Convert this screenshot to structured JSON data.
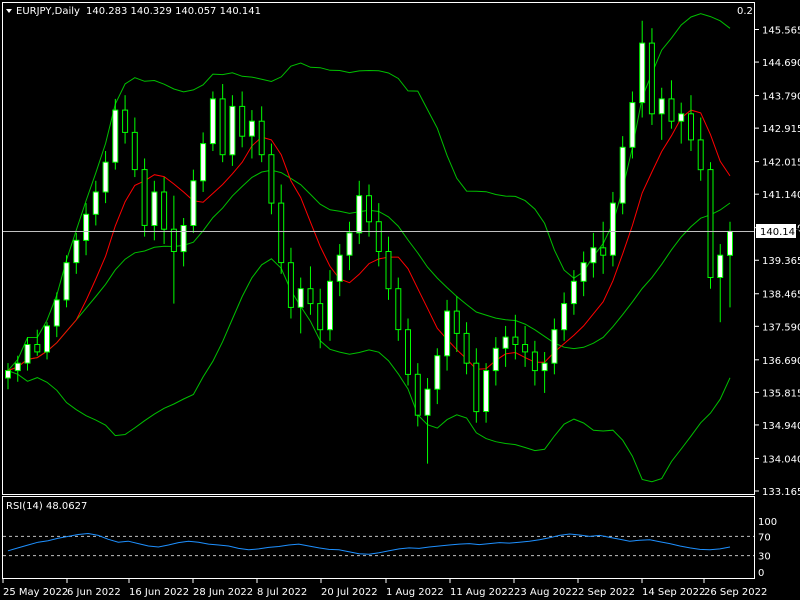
{
  "header": {
    "symbol": "EURJPY,Daily",
    "ohlc": "140.283 140.329 140.057 140.141",
    "spread": "0.2"
  },
  "rsi": {
    "label": "RSI(14) 48.0627",
    "ticks": [
      "100",
      "70",
      "30",
      "0"
    ]
  },
  "colors": {
    "background": "#000000",
    "frame": "#ffffff",
    "bull_candle": "#ffffff",
    "bear_candle": "#000000",
    "candle_outline": "#00ff00",
    "bands": "#00c000",
    "ma": "#ff0000",
    "rsi_line": "#1e90ff",
    "price_line": "#c0c0c0"
  },
  "chart_data": [
    {
      "type": "candlestick",
      "indicators": [
        "Bollinger Bands",
        "Moving Average"
      ],
      "ylim": [
        133.165,
        146.44
      ],
      "y_ticks": [
        "145.565",
        "144.690",
        "143.790",
        "142.915",
        "142.015",
        "141.140",
        "140.240",
        "139.365",
        "138.465",
        "137.590",
        "136.690",
        "135.815",
        "134.940",
        "134.040",
        "133.165"
      ],
      "x_ticks": [
        "25 May 2022",
        "6 Jun 2022",
        "16 Jun 2022",
        "28 Jun 2022",
        "8 Jul 2022",
        "20 Jul 2022",
        "1 Aug 2022",
        "11 Aug 2022",
        "23 Aug 2022",
        "2 Sep 2022",
        "14 Sep 2022",
        "26 Sep 2022"
      ],
      "current_price": "140.141",
      "candles": [
        [
          136.2,
          136.6,
          135.9,
          136.4
        ],
        [
          136.4,
          136.8,
          136.1,
          136.6
        ],
        [
          136.6,
          137.3,
          136.4,
          137.1
        ],
        [
          137.1,
          137.5,
          136.8,
          136.9
        ],
        [
          136.9,
          137.7,
          136.7,
          137.6
        ],
        [
          137.6,
          138.5,
          137.3,
          138.3
        ],
        [
          138.3,
          139.5,
          138.1,
          139.3
        ],
        [
          139.3,
          140.1,
          139.0,
          139.9
        ],
        [
          139.9,
          140.9,
          139.5,
          140.6
        ],
        [
          140.6,
          141.5,
          140.3,
          141.2
        ],
        [
          141.2,
          142.3,
          140.9,
          142.0
        ],
        [
          142.0,
          143.7,
          141.8,
          143.4
        ],
        [
          143.4,
          143.8,
          142.5,
          142.8
        ],
        [
          142.8,
          143.2,
          141.6,
          141.8
        ],
        [
          141.8,
          142.1,
          140.0,
          140.3
        ],
        [
          140.3,
          141.5,
          139.9,
          141.2
        ],
        [
          141.2,
          141.6,
          139.8,
          140.2
        ],
        [
          140.2,
          141.1,
          138.2,
          139.6
        ],
        [
          139.6,
          140.5,
          139.2,
          140.3
        ],
        [
          140.3,
          141.8,
          140.1,
          141.5
        ],
        [
          141.5,
          142.8,
          141.2,
          142.5
        ],
        [
          142.5,
          143.9,
          142.3,
          143.7
        ],
        [
          143.7,
          144.1,
          142.0,
          142.2
        ],
        [
          142.2,
          143.8,
          141.9,
          143.5
        ],
        [
          143.5,
          143.9,
          142.4,
          142.7
        ],
        [
          142.7,
          143.4,
          142.1,
          143.1
        ],
        [
          143.1,
          143.5,
          142.0,
          142.2
        ],
        [
          142.2,
          142.5,
          140.6,
          140.9
        ],
        [
          140.9,
          141.4,
          139.0,
          139.3
        ],
        [
          139.3,
          139.7,
          137.8,
          138.1
        ],
        [
          138.1,
          138.9,
          137.4,
          138.6
        ],
        [
          138.6,
          139.2,
          137.9,
          138.2
        ],
        [
          138.2,
          138.6,
          137.0,
          137.5
        ],
        [
          137.5,
          139.1,
          137.2,
          138.8
        ],
        [
          138.8,
          139.8,
          138.4,
          139.5
        ],
        [
          139.5,
          140.4,
          139.1,
          140.1
        ],
        [
          140.1,
          141.5,
          139.8,
          141.1
        ],
        [
          141.1,
          141.4,
          140.0,
          140.4
        ],
        [
          140.4,
          140.9,
          139.2,
          139.6
        ],
        [
          139.6,
          140.0,
          138.3,
          138.6
        ],
        [
          138.6,
          138.9,
          137.2,
          137.5
        ],
        [
          137.5,
          137.8,
          136.0,
          136.3
        ],
        [
          136.3,
          136.6,
          134.9,
          135.2
        ],
        [
          135.2,
          136.2,
          133.9,
          135.9
        ],
        [
          135.9,
          137.0,
          135.5,
          136.8
        ],
        [
          136.8,
          138.3,
          136.4,
          138.0
        ],
        [
          138.0,
          138.4,
          136.9,
          137.4
        ],
        [
          137.4,
          137.7,
          136.3,
          136.6
        ],
        [
          136.6,
          137.0,
          135.0,
          135.3
        ],
        [
          135.3,
          136.6,
          135.0,
          136.4
        ],
        [
          136.4,
          137.3,
          136.0,
          137.0
        ],
        [
          137.0,
          137.6,
          136.5,
          137.3
        ],
        [
          137.3,
          137.9,
          136.7,
          137.1
        ],
        [
          137.1,
          137.6,
          136.5,
          136.9
        ],
        [
          136.9,
          137.2,
          136.0,
          136.4
        ],
        [
          136.4,
          136.9,
          135.8,
          136.6
        ],
        [
          136.6,
          137.8,
          136.3,
          137.5
        ],
        [
          137.5,
          138.5,
          137.2,
          138.2
        ],
        [
          138.2,
          139.1,
          137.9,
          138.8
        ],
        [
          138.8,
          139.6,
          138.4,
          139.3
        ],
        [
          139.3,
          140.1,
          138.9,
          139.7
        ],
        [
          139.7,
          140.4,
          139.0,
          139.5
        ],
        [
          139.5,
          141.2,
          139.2,
          140.9
        ],
        [
          140.9,
          142.7,
          140.6,
          142.4
        ],
        [
          142.4,
          143.9,
          142.1,
          143.6
        ],
        [
          143.6,
          145.8,
          143.2,
          145.2
        ],
        [
          145.2,
          145.6,
          143.0,
          143.3
        ],
        [
          143.3,
          144.0,
          142.6,
          143.7
        ],
        [
          143.7,
          144.2,
          142.9,
          143.1
        ],
        [
          143.1,
          143.6,
          142.5,
          143.3
        ],
        [
          143.3,
          143.8,
          142.3,
          142.6
        ],
        [
          142.6,
          143.2,
          141.5,
          141.8
        ],
        [
          141.8,
          142.0,
          138.6,
          138.9
        ],
        [
          138.9,
          139.8,
          137.7,
          139.5
        ],
        [
          139.5,
          140.4,
          138.1,
          140.141
        ]
      ]
    },
    {
      "type": "line",
      "title": "RSI(14)",
      "ylim": [
        0,
        100
      ],
      "y_ticks": [
        "100",
        "70",
        "30",
        "0"
      ],
      "series": [
        {
          "name": "RSI(14)",
          "values": [
            40,
            46,
            52,
            58,
            61,
            66,
            70,
            74,
            76,
            72,
            64,
            58,
            60,
            55,
            50,
            48,
            52,
            57,
            60,
            58,
            54,
            52,
            50,
            45,
            42,
            44,
            47,
            49,
            52,
            54,
            50,
            46,
            43,
            42,
            38,
            34,
            33,
            36,
            40,
            44,
            46,
            45,
            48,
            50,
            52,
            54,
            55,
            53,
            55,
            57,
            56,
            58,
            60,
            63,
            67,
            72,
            75,
            73,
            70,
            72,
            68,
            64,
            60,
            62,
            63,
            59,
            55,
            50,
            46,
            43,
            42,
            44,
            48
          ]
        }
      ]
    }
  ]
}
